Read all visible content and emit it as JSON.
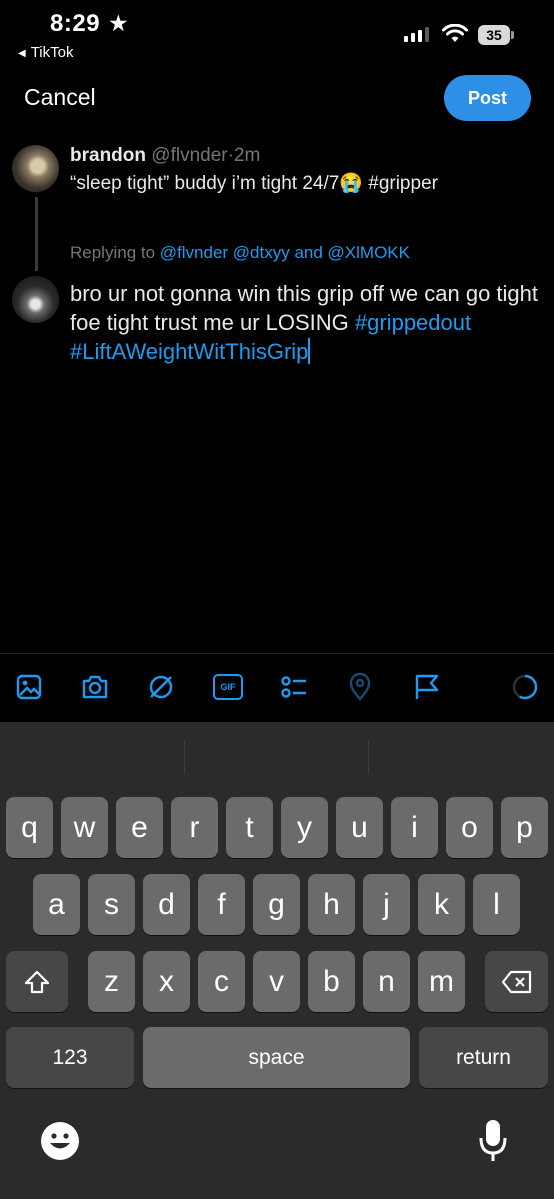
{
  "status_bar": {
    "time": "8:29",
    "back_app": "TikTok",
    "battery": "35"
  },
  "header": {
    "cancel_label": "Cancel",
    "post_label": "Post"
  },
  "original_tweet": {
    "name": "brandon",
    "handle": "@flvnder",
    "separator": "·",
    "age": "2m",
    "text": "“sleep tight” buddy i’m tight 24/7😭 #gripper"
  },
  "reply": {
    "replying_prefix": "Replying to",
    "replying_handles": "@flvnder @dtxyy and @XlMOKK",
    "text_plain": "bro ur not gonna win this grip off we can go tight foe tight trust me ur LOSING",
    "hashtags": "#grippedout #LiftAWeightWitThisGrip"
  },
  "toolbar": {
    "icons": [
      "image-icon",
      "camera-icon",
      "grok-icon",
      "gif-icon",
      "poll-icon",
      "location-icon",
      "flag-icon",
      "progress-ring-icon"
    ],
    "gif_text": "GIF",
    "accent": "#1d9bf0"
  },
  "keyboard": {
    "row1": [
      "q",
      "w",
      "e",
      "r",
      "t",
      "y",
      "u",
      "i",
      "o",
      "p"
    ],
    "row2": [
      "a",
      "s",
      "d",
      "f",
      "g",
      "h",
      "j",
      "k",
      "l"
    ],
    "row3": [
      "z",
      "x",
      "c",
      "v",
      "b",
      "n",
      "m"
    ],
    "numbers_label": "123",
    "space_label": "space",
    "return_label": "return"
  }
}
